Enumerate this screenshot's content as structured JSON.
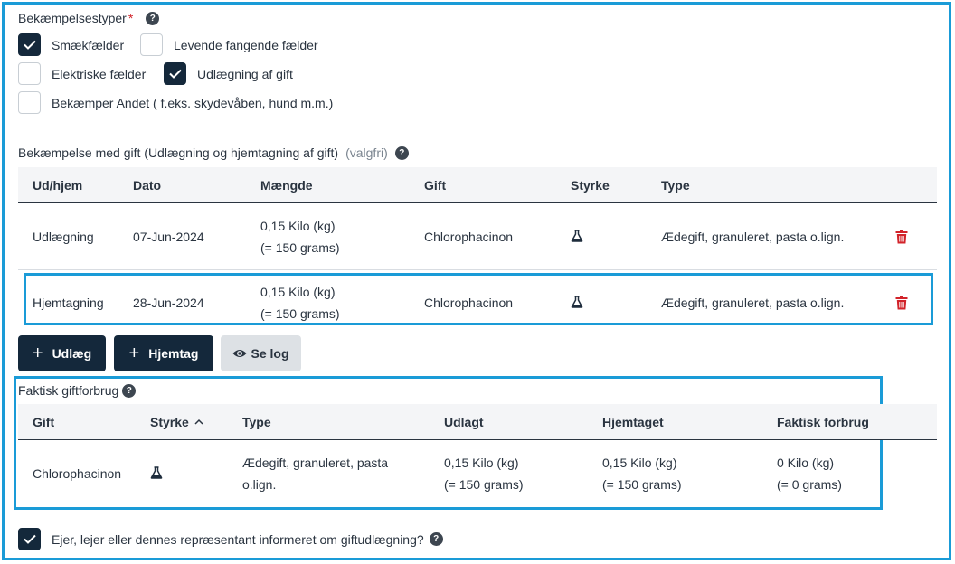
{
  "bekaempelsestyper": {
    "label": "Bekæmpelsestyper",
    "required_mark": "*",
    "options": [
      {
        "label": "Smækfælder",
        "checked": true
      },
      {
        "label": "Levende fangende fælder",
        "checked": false
      },
      {
        "label": "Elektriske fælder",
        "checked": false
      },
      {
        "label": "Udlægning af gift",
        "checked": true
      },
      {
        "label": "Bekæmper Andet ( f.eks. skydevåben, hund m.m.)",
        "checked": false
      }
    ]
  },
  "gift_section": {
    "label": "Bekæmpelse med gift (Udlægning og hjemtagning af gift)",
    "optional": "(valgfri)",
    "columns": [
      "Ud/hjem",
      "Dato",
      "Mængde",
      "Gift",
      "Styrke",
      "Type"
    ],
    "rows": [
      {
        "udhjem": "Udlægning",
        "dato": "07-Jun-2024",
        "maengde1": "0,15 Kilo (kg)",
        "maengde2": "(= 150 grams)",
        "gift": "Chlorophacinon",
        "type": "Ædegift, granuleret, pasta o.lign."
      },
      {
        "udhjem": "Hjemtagning",
        "dato": "28-Jun-2024",
        "maengde1": "0,15 Kilo (kg)",
        "maengde2": "(= 150 grams)",
        "gift": "Chlorophacinon",
        "type": "Ædegift, granuleret, pasta o.lign."
      }
    ],
    "buttons": {
      "udlaeg": "Udlæg",
      "hjemtag": "Hjemtag",
      "selog": "Se log"
    }
  },
  "forbrug": {
    "label": "Faktisk giftforbrug",
    "columns": [
      "Gift",
      "Styrke",
      "Type",
      "Udlagt",
      "Hjemtaget",
      "Faktisk forbrug"
    ],
    "row": {
      "gift": "Chlorophacinon",
      "type1": "Ædegift, granuleret, pasta",
      "type2": "o.lign.",
      "udlagt1": "0,15 Kilo (kg)",
      "udlagt2": "(= 150 grams)",
      "hjemtaget1": "0,15 Kilo (kg)",
      "hjemtaget2": "(= 150 grams)",
      "forbrug1": "0 Kilo (kg)",
      "forbrug2": "(= 0 grams)"
    }
  },
  "informed": {
    "label": "Ejer, lejer eller dennes repræsentant informeret om giftudlægning?",
    "checked": true
  },
  "colors": {
    "accent": "#1a9bd7",
    "dark": "#14283b",
    "danger": "#d2232a"
  }
}
